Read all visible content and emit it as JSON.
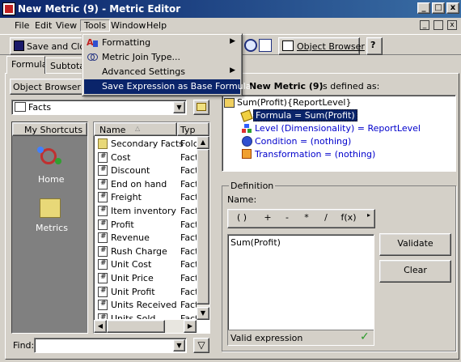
{
  "window": {
    "title": "New Metric (9) - Metric Editor",
    "controls": [
      "_",
      "□",
      "x"
    ]
  },
  "menubar": {
    "items": [
      "File",
      "Edit",
      "View",
      "Tools",
      "Window",
      "Help"
    ]
  },
  "toolbar": {
    "save_close_label": "Save and Close",
    "object_browser_label": "Object Browser"
  },
  "tabs": {
    "formula": "Formula",
    "subtotals": "Subtotals"
  },
  "tools_menu": {
    "items": [
      {
        "label": "Formatting",
        "submenu": true
      },
      {
        "label": "Metric Join Type...",
        "submenu": false
      },
      {
        "label": "Advanced Settings",
        "submenu": true
      },
      {
        "label": "Save Expression as Base Formula",
        "submenu": false
      }
    ]
  },
  "object_browser": {
    "label": "Object Browser",
    "folder": "Facts",
    "shortcuts_label": "My Shortcuts",
    "shortcuts": [
      {
        "label": "Home",
        "icon": "home-icon"
      },
      {
        "label": "Metrics",
        "icon": "folder-icon"
      }
    ],
    "columns": {
      "name": "Name",
      "type": "Typ"
    },
    "rows": [
      {
        "name": "Secondary Facts",
        "type": "Folc",
        "icon": "folder-icon"
      },
      {
        "name": "Cost",
        "type": "Fact",
        "icon": "fact-icon"
      },
      {
        "name": "Discount",
        "type": "Fact",
        "icon": "fact-icon"
      },
      {
        "name": "End on hand",
        "type": "Fact",
        "icon": "fact-icon"
      },
      {
        "name": "Freight",
        "type": "Fact",
        "icon": "fact-icon"
      },
      {
        "name": "Item inventory",
        "type": "Fact",
        "icon": "fact-icon"
      },
      {
        "name": "Profit",
        "type": "Fact",
        "icon": "fact-icon"
      },
      {
        "name": "Revenue",
        "type": "Fact",
        "icon": "fact-icon"
      },
      {
        "name": "Rush Charge",
        "type": "Fact",
        "icon": "fact-icon"
      },
      {
        "name": "Unit Cost",
        "type": "Fact",
        "icon": "fact-icon"
      },
      {
        "name": "Unit Price",
        "type": "Fact",
        "icon": "fact-icon"
      },
      {
        "name": "Unit Profit",
        "type": "Fact",
        "icon": "fact-icon"
      },
      {
        "name": "Units Received",
        "type": "Fact",
        "icon": "fact-icon"
      },
      {
        "name": "Units Sold",
        "type": "Fact",
        "icon": "fact-icon"
      }
    ],
    "find_label": "Find:"
  },
  "definition_tree": {
    "heading_prefix": "",
    "metric_name": "New Metric (9)",
    "heading_suffix": "is defined as:",
    "root": "Sum(Profit){ReportLevel}",
    "children": [
      {
        "label": "Formula = Sum(Profit)",
        "color": "#000000",
        "selected": true
      },
      {
        "label": "Level (Dimensionality) = ReportLevel",
        "color": "#0000cc",
        "selected": false
      },
      {
        "label": "Condition = (nothing)",
        "color": "#0000cc",
        "selected": false
      },
      {
        "label": "Transformation = (nothing)",
        "color": "#0000cc",
        "selected": false
      }
    ]
  },
  "definition": {
    "group_label": "Definition",
    "name_label": "Name:",
    "operators": [
      "( )",
      "+",
      "-",
      "*",
      "/",
      "f(x)"
    ],
    "expression": "Sum(Profit)",
    "status": "Valid expression",
    "validate_label": "Validate",
    "clear_label": "Clear"
  },
  "colors": {
    "title_bar": "#0a246a",
    "highlight": "#0a246a",
    "tree_link": "#0000cc",
    "valid_check": "#2a9a2a"
  }
}
